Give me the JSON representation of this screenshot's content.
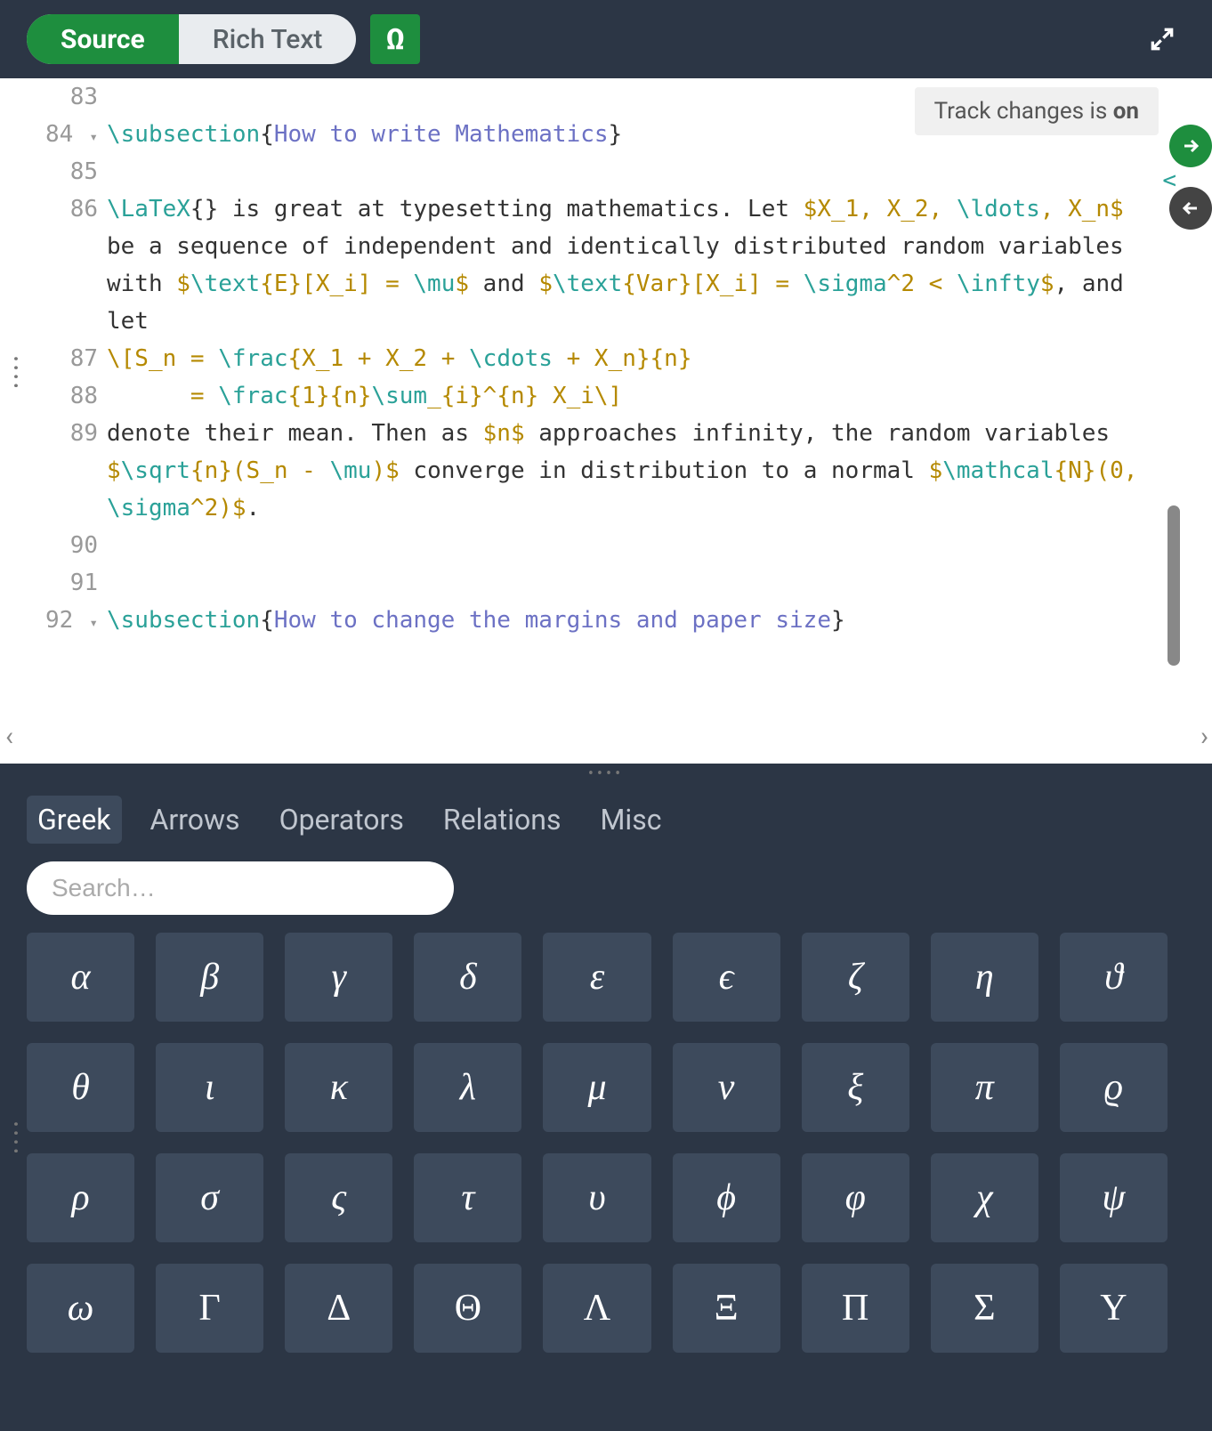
{
  "toolbar": {
    "tabs": {
      "source": "Source",
      "rich_text": "Rich Text"
    },
    "omega_label": "Ω"
  },
  "track_changes": {
    "prefix": "Track changes is ",
    "state": "on"
  },
  "editor": {
    "lines": [
      {
        "n": "83",
        "fold": "",
        "parts": []
      },
      {
        "n": "84",
        "fold": "▾",
        "parts": [
          {
            "t": "\\subsection",
            "c": "tok-cmd"
          },
          {
            "t": "{",
            "c": ""
          },
          {
            "t": "How to write Mathematics",
            "c": "tok-arg"
          },
          {
            "t": "}",
            "c": ""
          }
        ]
      },
      {
        "n": "85",
        "fold": "",
        "parts": []
      },
      {
        "n": "86",
        "fold": "",
        "parts": [
          {
            "t": "\\LaTeX",
            "c": "tok-cmd"
          },
          {
            "t": "{} is great at typesetting mathematics. Let ",
            "c": ""
          },
          {
            "t": "$X_1, X_2, ",
            "c": "tok-math"
          },
          {
            "t": "\\ldots",
            "c": "tok-cmd"
          },
          {
            "t": ", X_n$",
            "c": "tok-math"
          },
          {
            "t": " be a sequence of independent and identically distributed random variables with ",
            "c": ""
          },
          {
            "t": "$",
            "c": "tok-math"
          },
          {
            "t": "\\text",
            "c": "tok-cmd"
          },
          {
            "t": "{E}[X_i] = ",
            "c": "tok-math"
          },
          {
            "t": "\\mu",
            "c": "tok-cmd"
          },
          {
            "t": "$",
            "c": "tok-math"
          },
          {
            "t": " and ",
            "c": ""
          },
          {
            "t": "$",
            "c": "tok-math"
          },
          {
            "t": "\\text",
            "c": "tok-cmd"
          },
          {
            "t": "{Var}[X_i] = ",
            "c": "tok-math"
          },
          {
            "t": "\\sigma",
            "c": "tok-cmd"
          },
          {
            "t": "^2 < ",
            "c": "tok-math"
          },
          {
            "t": "\\infty",
            "c": "tok-cmd"
          },
          {
            "t": "$",
            "c": "tok-math"
          },
          {
            "t": ", and let",
            "c": ""
          }
        ]
      },
      {
        "n": "87",
        "fold": "",
        "parts": [
          {
            "t": "\\[S_n = ",
            "c": "tok-math"
          },
          {
            "t": "\\frac",
            "c": "tok-cmd"
          },
          {
            "t": "{X_1 + X_2 + ",
            "c": "tok-math"
          },
          {
            "t": "\\cdots",
            "c": "tok-cmd"
          },
          {
            "t": " + X_n}{n}",
            "c": "tok-math"
          }
        ]
      },
      {
        "n": "88",
        "fold": "",
        "parts": [
          {
            "t": "      = ",
            "c": "tok-math"
          },
          {
            "t": "\\frac",
            "c": "tok-cmd"
          },
          {
            "t": "{1}{n}",
            "c": "tok-math"
          },
          {
            "t": "\\sum",
            "c": "tok-cmd"
          },
          {
            "t": "_{i}^{n} X_i",
            "c": "tok-math"
          },
          {
            "t": "\\]",
            "c": "tok-math"
          }
        ]
      },
      {
        "n": "89",
        "fold": "",
        "parts": [
          {
            "t": "denote their mean. Then as ",
            "c": ""
          },
          {
            "t": "$n$",
            "c": "tok-math"
          },
          {
            "t": " approaches infinity, the random variables ",
            "c": ""
          },
          {
            "t": "$",
            "c": "tok-math"
          },
          {
            "t": "\\sqrt",
            "c": "tok-cmd"
          },
          {
            "t": "{n}(S_n - ",
            "c": "tok-math"
          },
          {
            "t": "\\mu",
            "c": "tok-cmd"
          },
          {
            "t": ")$",
            "c": "tok-math"
          },
          {
            "t": " converge in distribution to a normal ",
            "c": ""
          },
          {
            "t": "$",
            "c": "tok-math"
          },
          {
            "t": "\\mathcal",
            "c": "tok-cmd"
          },
          {
            "t": "{N}(0, ",
            "c": "tok-math"
          },
          {
            "t": "\\sigma",
            "c": "tok-cmd"
          },
          {
            "t": "^2)$",
            "c": "tok-math"
          },
          {
            "t": ".",
            "c": ""
          }
        ]
      },
      {
        "n": "90",
        "fold": "",
        "parts": []
      },
      {
        "n": "91",
        "fold": "",
        "parts": []
      },
      {
        "n": "92",
        "fold": "▾",
        "parts": [
          {
            "t": "\\subsection",
            "c": "tok-cmd"
          },
          {
            "t": "{",
            "c": ""
          },
          {
            "t": "How to change the margins and paper size",
            "c": "tok-arg"
          },
          {
            "t": "}",
            "c": ""
          }
        ]
      }
    ]
  },
  "symbol_panel": {
    "tabs": [
      "Greek",
      "Arrows",
      "Operators",
      "Relations",
      "Misc"
    ],
    "active_tab": 0,
    "search_placeholder": "Search…",
    "symbols": [
      {
        "g": "α",
        "u": false
      },
      {
        "g": "β",
        "u": false
      },
      {
        "g": "γ",
        "u": false
      },
      {
        "g": "δ",
        "u": false
      },
      {
        "g": "ε",
        "u": false
      },
      {
        "g": "ϵ",
        "u": false
      },
      {
        "g": "ζ",
        "u": false
      },
      {
        "g": "η",
        "u": false
      },
      {
        "g": "ϑ",
        "u": false
      },
      {
        "g": "θ",
        "u": false
      },
      {
        "g": "ι",
        "u": false
      },
      {
        "g": "κ",
        "u": false
      },
      {
        "g": "λ",
        "u": false
      },
      {
        "g": "μ",
        "u": false
      },
      {
        "g": "ν",
        "u": false
      },
      {
        "g": "ξ",
        "u": false
      },
      {
        "g": "π",
        "u": false
      },
      {
        "g": "ϱ",
        "u": false
      },
      {
        "g": "ρ",
        "u": false
      },
      {
        "g": "σ",
        "u": false
      },
      {
        "g": "ς",
        "u": false
      },
      {
        "g": "τ",
        "u": false
      },
      {
        "g": "υ",
        "u": false
      },
      {
        "g": "ϕ",
        "u": false
      },
      {
        "g": "φ",
        "u": false
      },
      {
        "g": "χ",
        "u": false
      },
      {
        "g": "ψ",
        "u": false
      },
      {
        "g": "ω",
        "u": false
      },
      {
        "g": "Γ",
        "u": true
      },
      {
        "g": "Δ",
        "u": true
      },
      {
        "g": "Θ",
        "u": true
      },
      {
        "g": "Λ",
        "u": true
      },
      {
        "g": "Ξ",
        "u": true
      },
      {
        "g": "Π",
        "u": true
      },
      {
        "g": "Σ",
        "u": true
      },
      {
        "g": "Υ",
        "u": true
      }
    ]
  }
}
